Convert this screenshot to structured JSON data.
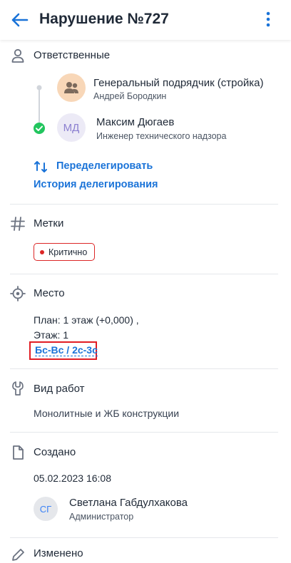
{
  "header": {
    "title": "Нарушение №727"
  },
  "responsible": {
    "title": "Ответственные",
    "people": [
      {
        "name": "Генеральный подрядчик (стройка)",
        "sub": "Андрей Бородкин",
        "avatar": "group-avatar",
        "avatar_bg": "#f8d7b8"
      },
      {
        "name": "Максим Дюгаев",
        "sub": "Инженер технического надзора",
        "initials": "МД",
        "avatar_bg": "#eceaf6",
        "avatar_color": "#8b7fd0"
      }
    ],
    "redelegate_label": "Переделегировать",
    "history_label": "История делегирования"
  },
  "tags": {
    "title": "Метки",
    "items": [
      {
        "label": "Критично",
        "color": "#dc2626"
      }
    ]
  },
  "place": {
    "title": "Место",
    "plan": "План: 1 этаж (+0,000) ,",
    "floor": "Этаж: 1",
    "axes": "Бс-Вс / 2с-3с"
  },
  "work_type": {
    "title": "Вид работ",
    "value": "Монолитные и ЖБ конструкции"
  },
  "created": {
    "title": "Создано",
    "datetime": "05.02.2023 16:08",
    "user_name": "Светлана Габдулхакова",
    "user_role": "Администратор",
    "initials": "СГ"
  },
  "changed": {
    "title": "Изменено"
  },
  "colors": {
    "accent": "#1a73d8",
    "text": "#1f2937",
    "muted": "#6b7280",
    "check": "#22c55e",
    "highlight_border": "#e11d24"
  }
}
